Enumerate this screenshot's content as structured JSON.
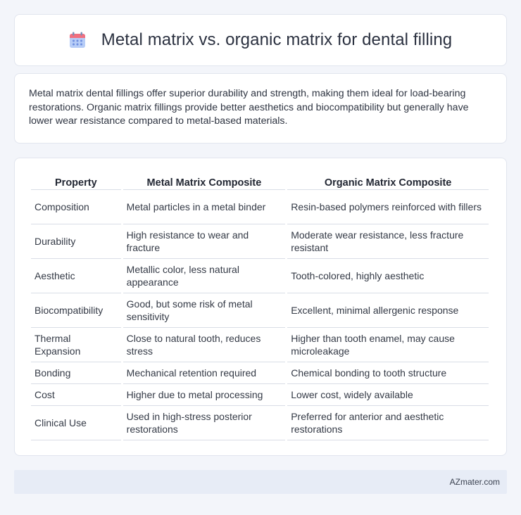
{
  "header": {
    "title": "Metal matrix vs. organic matrix for dental filling",
    "icon": "calendar-icon",
    "icon_colors": {
      "top": "#f06a7a",
      "body": "#a9c4f5",
      "dots": "#6f8fe0"
    }
  },
  "summary": {
    "text": "Metal matrix dental fillings offer superior durability and strength, making them ideal for load-bearing restorations. Organic matrix fillings provide better aesthetics and biocompatibility but generally have lower wear resistance compared to metal-based materials."
  },
  "table": {
    "headers": [
      "Property",
      "Metal Matrix Composite",
      "Organic Matrix Composite"
    ],
    "rows": [
      [
        "Composition",
        "Metal particles in a metal binder",
        "Resin-based polymers reinforced with fillers"
      ],
      [
        "Durability",
        "High resistance to wear and fracture",
        "Moderate wear resistance, less fracture resistant"
      ],
      [
        "Aesthetic",
        "Metallic color, less natural appearance",
        "Tooth-colored, highly aesthetic"
      ],
      [
        "Biocompatibility",
        "Good, but some risk of metal sensitivity",
        "Excellent, minimal allergenic response"
      ],
      [
        "Thermal Expansion",
        "Close to natural tooth, reduces stress",
        "Higher than tooth enamel, may cause microleakage"
      ],
      [
        "Bonding",
        "Mechanical retention required",
        "Chemical bonding to tooth structure"
      ],
      [
        "Cost",
        "Higher due to metal processing",
        "Lower cost, widely available"
      ],
      [
        "Clinical Use",
        "Used in high-stress posterior restorations",
        "Preferred for anterior and aesthetic restorations"
      ]
    ]
  },
  "footer": {
    "text": "AZmater.com"
  }
}
